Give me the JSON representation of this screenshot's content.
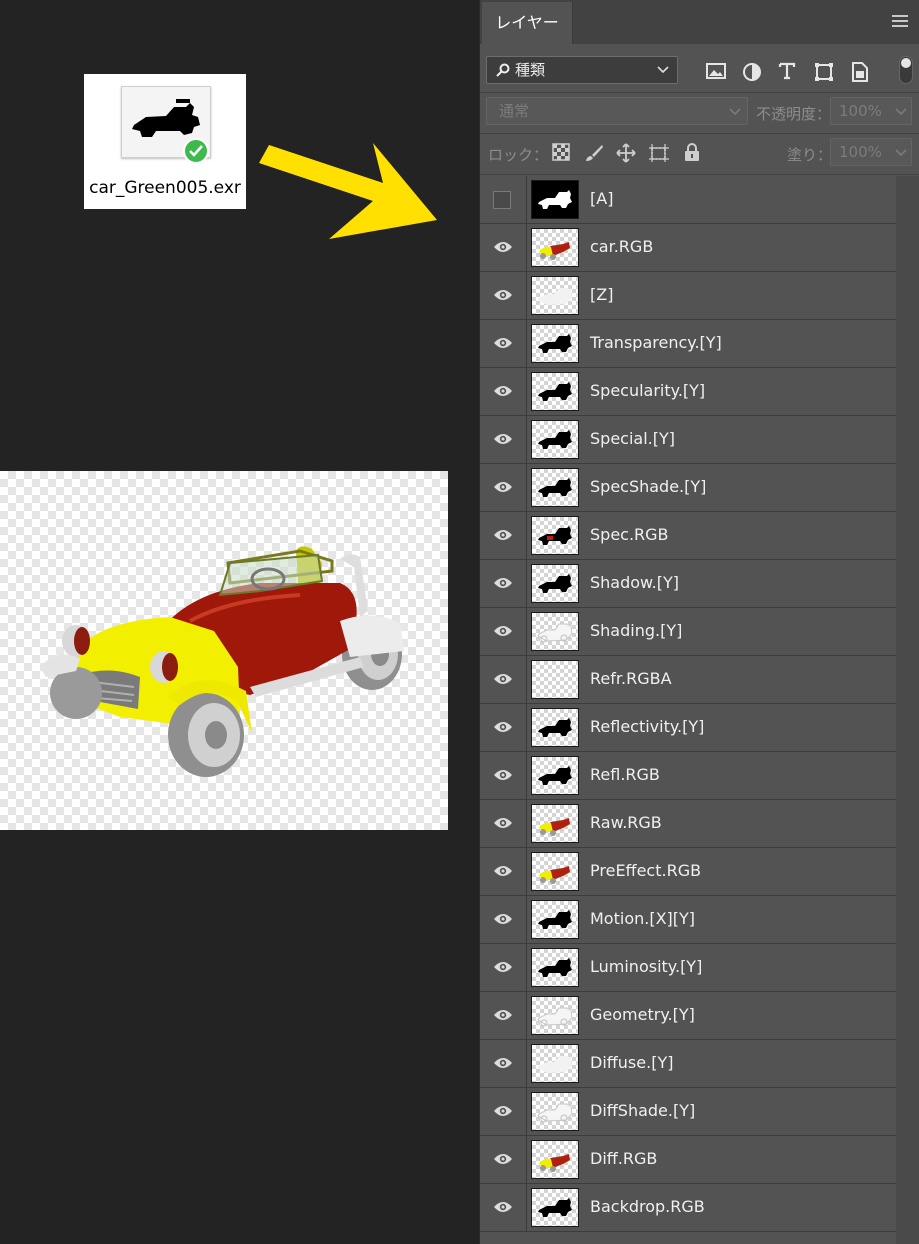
{
  "file": {
    "name": "car_Green005.exr",
    "thumbnail_icon": "car-silhouette-icon",
    "status_icon": "checkmark-icon"
  },
  "arrow": {
    "color": "#ffe000",
    "icon": "arrow-right-icon"
  },
  "preview": {
    "icon": "yellow-red-roadster-car-render"
  },
  "panel": {
    "tab_label": "レイヤー",
    "menu_icon": "hamburger-menu-icon",
    "filter": {
      "kind_label": "種類",
      "icons": [
        "image-filter-icon",
        "adjustment-filter-icon",
        "type-filter-icon",
        "shape-filter-icon",
        "smart-object-filter-icon"
      ]
    },
    "blend_mode": "通常",
    "opacity_label": "不透明度：",
    "opacity_value": "100%",
    "lock_label": "ロック：",
    "lock_icons": [
      "lock-transparent-pixels-icon",
      "lock-image-pixels-icon",
      "lock-position-icon",
      "lock-artboard-icon",
      "lock-all-icon"
    ],
    "fill_label": "塗り：",
    "fill_value": "100%"
  },
  "layers": [
    {
      "name": "[A]",
      "visible": false,
      "thumb": "black"
    },
    {
      "name": "car.RGB",
      "visible": true,
      "thumb": "color"
    },
    {
      "name": "[Z]",
      "visible": true,
      "thumb": "light"
    },
    {
      "name": "Transparency.[Y]",
      "visible": true,
      "thumb": "silhouette"
    },
    {
      "name": "Specularity.[Y]",
      "visible": true,
      "thumb": "silhouette"
    },
    {
      "name": "Special.[Y]",
      "visible": true,
      "thumb": "silhouette"
    },
    {
      "name": "SpecShade.[Y]",
      "visible": true,
      "thumb": "silhouette"
    },
    {
      "name": "Spec.RGB",
      "visible": true,
      "thumb": "silhouette-red"
    },
    {
      "name": "Shadow.[Y]",
      "visible": true,
      "thumb": "silhouette"
    },
    {
      "name": "Shading.[Y]",
      "visible": true,
      "thumb": "outline"
    },
    {
      "name": "Refr.RGBA",
      "visible": true,
      "thumb": "empty"
    },
    {
      "name": "Reflectivity.[Y]",
      "visible": true,
      "thumb": "silhouette"
    },
    {
      "name": "Refl.RGB",
      "visible": true,
      "thumb": "silhouette"
    },
    {
      "name": "Raw.RGB",
      "visible": true,
      "thumb": "color"
    },
    {
      "name": "PreEffect.RGB",
      "visible": true,
      "thumb": "color"
    },
    {
      "name": "Motion.[X][Y]",
      "visible": true,
      "thumb": "silhouette"
    },
    {
      "name": "Luminosity.[Y]",
      "visible": true,
      "thumb": "silhouette"
    },
    {
      "name": "Geometry.[Y]",
      "visible": true,
      "thumb": "outline"
    },
    {
      "name": "Diffuse.[Y]",
      "visible": true,
      "thumb": "light"
    },
    {
      "name": "DiffShade.[Y]",
      "visible": true,
      "thumb": "outline"
    },
    {
      "name": "Diff.RGB",
      "visible": true,
      "thumb": "color"
    },
    {
      "name": "Backdrop.RGB",
      "visible": true,
      "thumb": "silhouette"
    }
  ]
}
